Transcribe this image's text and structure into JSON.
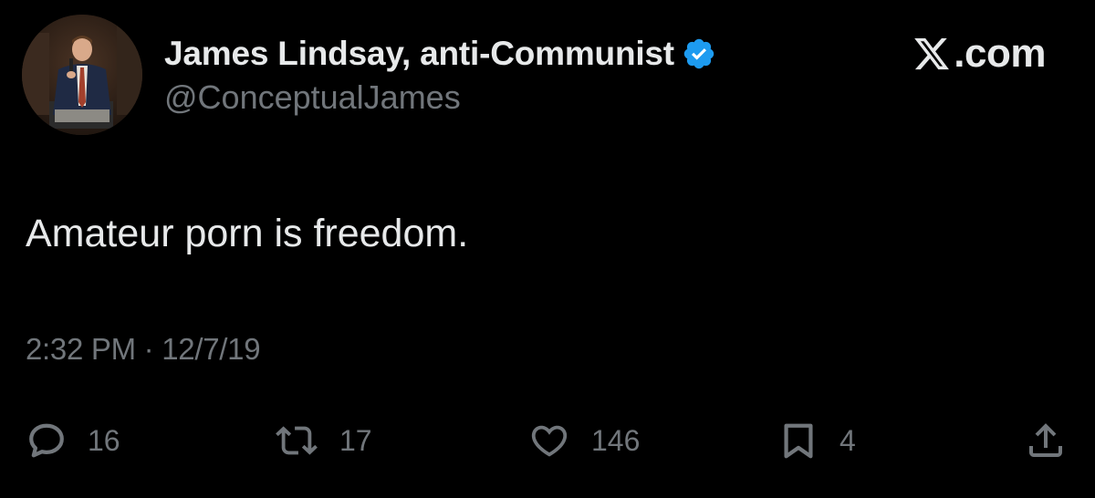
{
  "author": {
    "display_name": "James Lindsay, anti-Communist",
    "handle": "@ConceptualJames",
    "verified": true,
    "verified_color": "#1d9bf0"
  },
  "brand": {
    "text": ".com",
    "icon": "x-logo-icon"
  },
  "tweet": {
    "text": "Amateur porn is freedom.",
    "time": "2:32 PM",
    "separator": "·",
    "date": "12/7/19"
  },
  "actions": {
    "reply": {
      "icon": "reply-icon",
      "count": "16"
    },
    "retweet": {
      "icon": "retweet-icon",
      "count": "17"
    },
    "like": {
      "icon": "heart-icon",
      "count": "146"
    },
    "bookmark": {
      "icon": "bookmark-icon",
      "count": "4"
    },
    "share": {
      "icon": "share-icon"
    }
  },
  "colors": {
    "background": "#000000",
    "primary_text": "#e7e9ea",
    "secondary_text": "#71767b",
    "accent": "#1d9bf0"
  }
}
